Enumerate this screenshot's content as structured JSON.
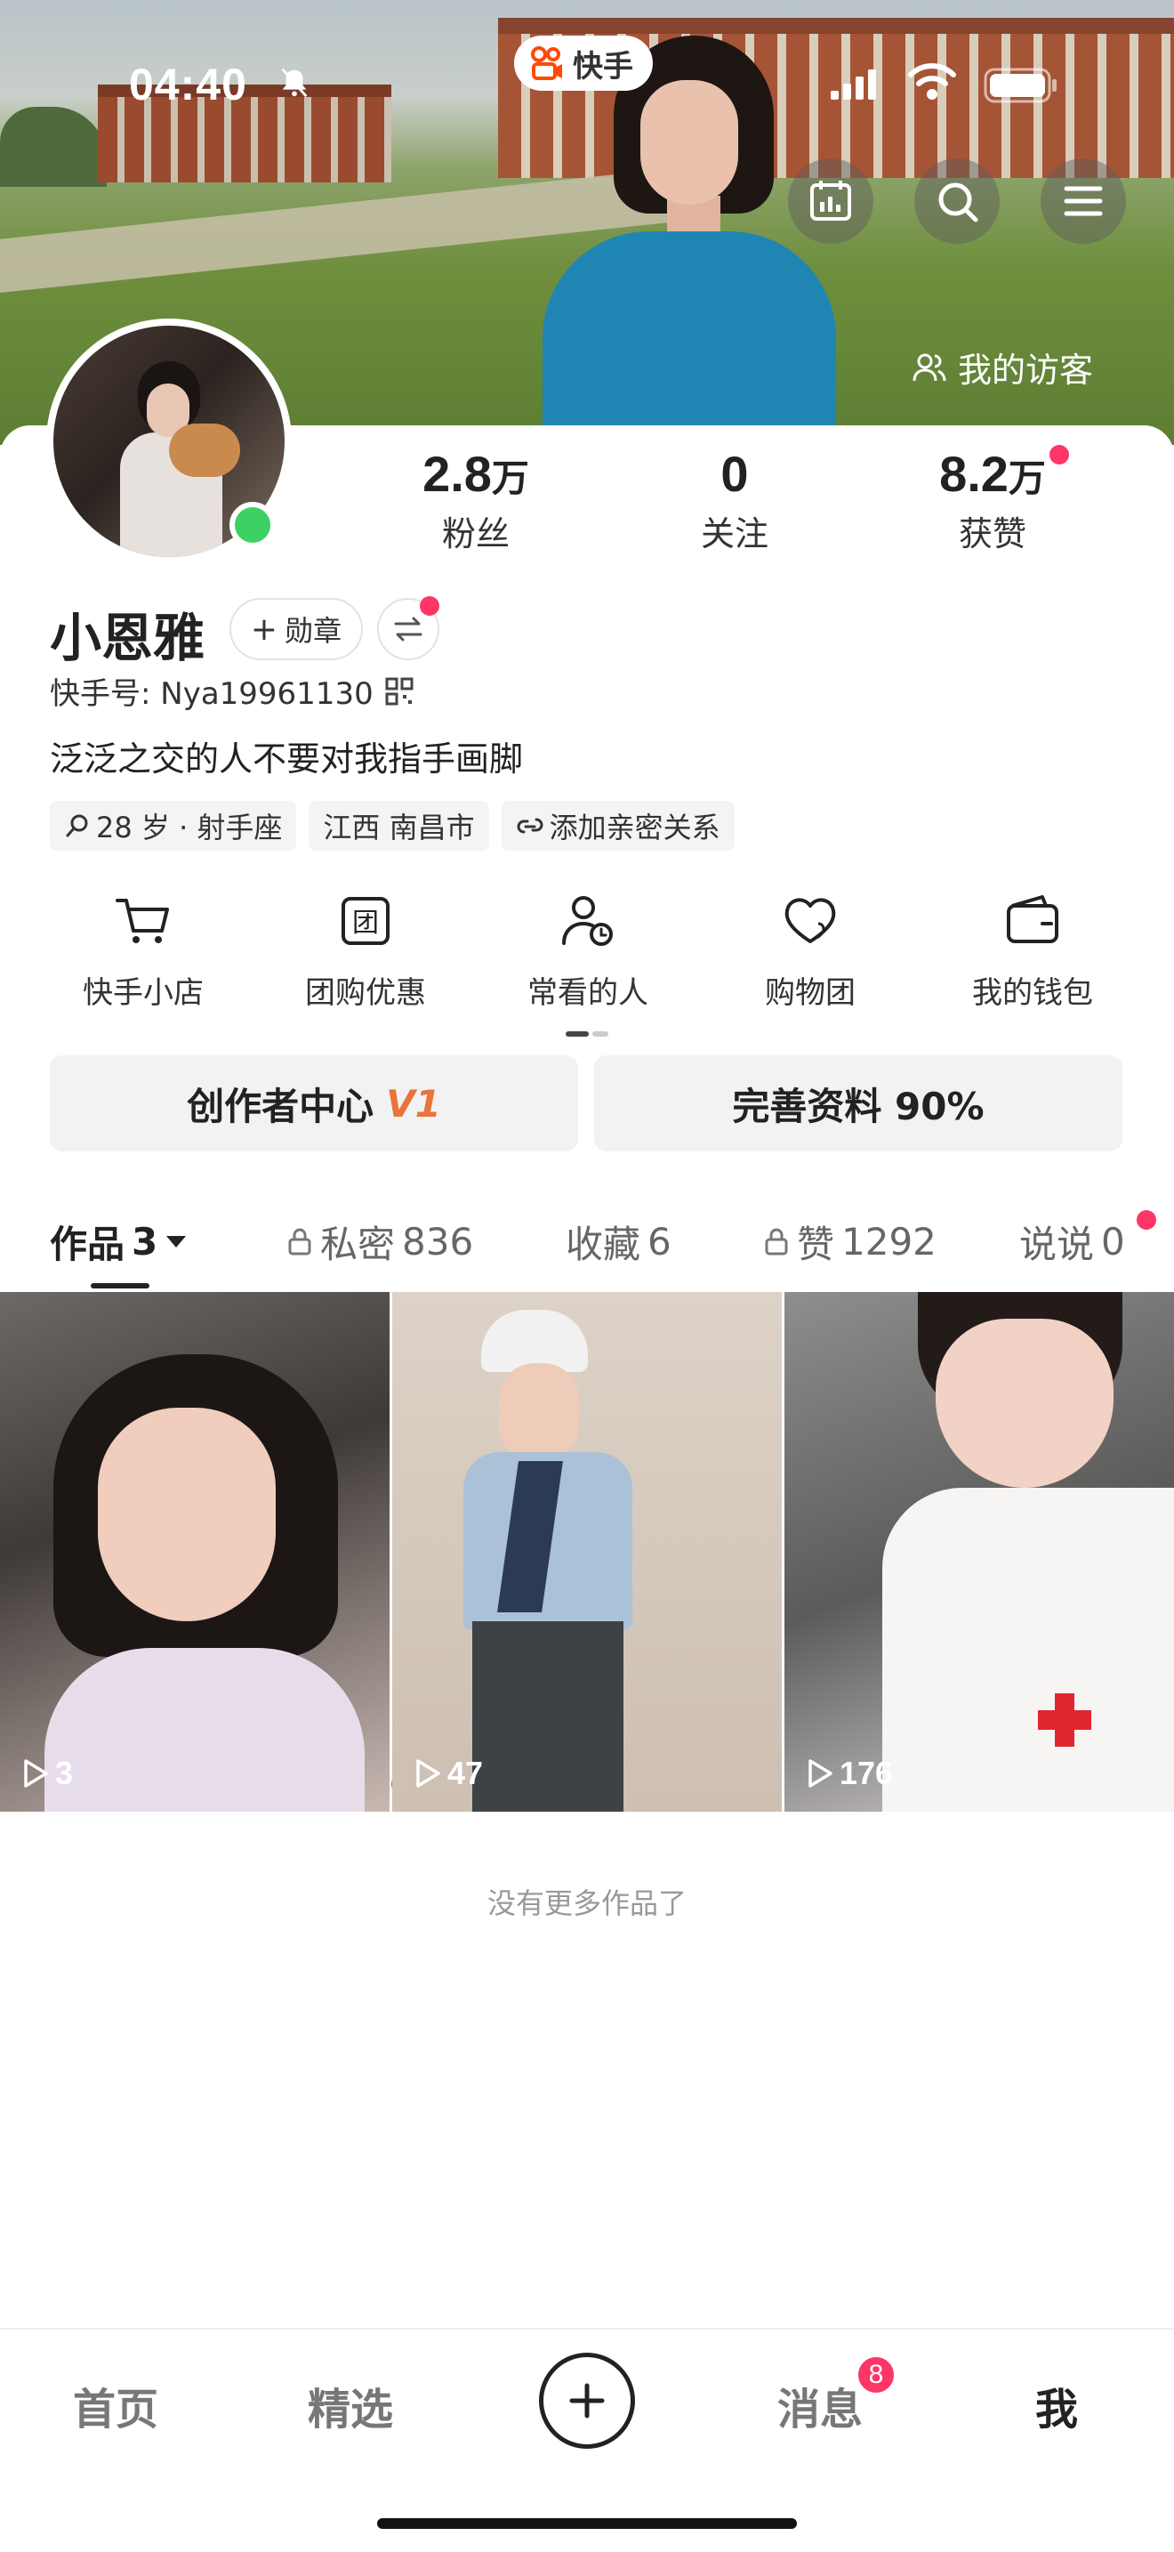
{
  "status_bar": {
    "time": "04:40"
  },
  "app_pill": {
    "label": "快手"
  },
  "header": {
    "visitor_label": "我的访客"
  },
  "profile": {
    "stats": [
      {
        "num": "2.8",
        "unit": "万",
        "label": "粉丝"
      },
      {
        "num": "0",
        "unit": "",
        "label": "关注"
      },
      {
        "num": "8.2",
        "unit": "万",
        "label": "获赞"
      }
    ],
    "name": "小恩雅",
    "badge_label": "勋章",
    "uid": "快手号: Nya19961130",
    "bio": "泛泛之交的人不要对我指手画脚",
    "tags": [
      {
        "icon": "search-icon",
        "text": "28 岁 · 射手座"
      },
      {
        "icon": "",
        "text": "江西 南昌市"
      },
      {
        "icon": "link-cloud-icon",
        "text": "添加亲密关系"
      }
    ]
  },
  "quick_actions": [
    {
      "icon": "cart-icon",
      "label": "快手小店"
    },
    {
      "icon": "group-buy-icon",
      "label": "团购优惠"
    },
    {
      "icon": "person-clock-icon",
      "label": "常看的人"
    },
    {
      "icon": "heart-bag-icon",
      "label": "购物团"
    },
    {
      "icon": "wallet-icon",
      "label": "我的钱包"
    }
  ],
  "buttons": {
    "creator_center": "创作者中心",
    "creator_level": "V1",
    "complete_profile": "完善资料 90%"
  },
  "tabs": [
    {
      "label": "作品",
      "count": "3"
    },
    {
      "label": "私密",
      "count": "836"
    },
    {
      "label": "收藏",
      "count": "6"
    },
    {
      "label": "赞",
      "count": "1292"
    },
    {
      "label": "说说",
      "count": "0"
    }
  ],
  "works": [
    {
      "plays": "3"
    },
    {
      "plays": "47"
    },
    {
      "plays": "176"
    }
  ],
  "no_more": "没有更多作品了",
  "bottom_nav": {
    "home": "首页",
    "featured": "精选",
    "messages": "消息",
    "messages_badge": "8",
    "me": "我"
  },
  "colors": {
    "accent_red": "#fe3666",
    "online_green": "#3dd063",
    "creator_orange": "#e8743b"
  }
}
